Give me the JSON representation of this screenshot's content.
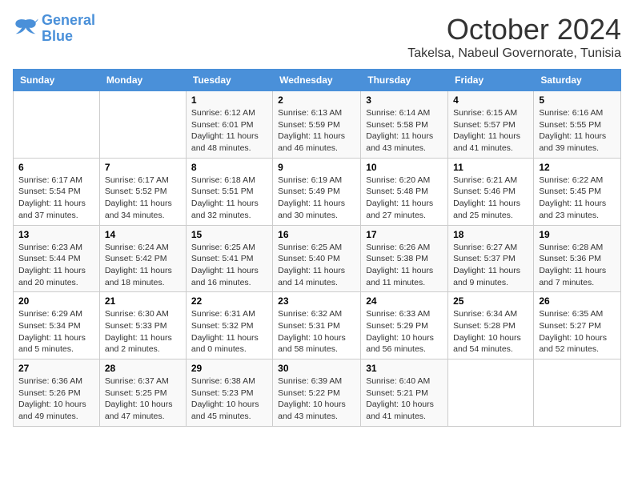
{
  "logo": {
    "line1": "General",
    "line2": "Blue"
  },
  "title": "October 2024",
  "subtitle": "Takelsa, Nabeul Governorate, Tunisia",
  "days_of_week": [
    "Sunday",
    "Monday",
    "Tuesday",
    "Wednesday",
    "Thursday",
    "Friday",
    "Saturday"
  ],
  "weeks": [
    [
      {
        "day": "",
        "info": ""
      },
      {
        "day": "",
        "info": ""
      },
      {
        "day": "1",
        "info": "Sunrise: 6:12 AM\nSunset: 6:01 PM\nDaylight: 11 hours and 48 minutes."
      },
      {
        "day": "2",
        "info": "Sunrise: 6:13 AM\nSunset: 5:59 PM\nDaylight: 11 hours and 46 minutes."
      },
      {
        "day": "3",
        "info": "Sunrise: 6:14 AM\nSunset: 5:58 PM\nDaylight: 11 hours and 43 minutes."
      },
      {
        "day": "4",
        "info": "Sunrise: 6:15 AM\nSunset: 5:57 PM\nDaylight: 11 hours and 41 minutes."
      },
      {
        "day": "5",
        "info": "Sunrise: 6:16 AM\nSunset: 5:55 PM\nDaylight: 11 hours and 39 minutes."
      }
    ],
    [
      {
        "day": "6",
        "info": "Sunrise: 6:17 AM\nSunset: 5:54 PM\nDaylight: 11 hours and 37 minutes."
      },
      {
        "day": "7",
        "info": "Sunrise: 6:17 AM\nSunset: 5:52 PM\nDaylight: 11 hours and 34 minutes."
      },
      {
        "day": "8",
        "info": "Sunrise: 6:18 AM\nSunset: 5:51 PM\nDaylight: 11 hours and 32 minutes."
      },
      {
        "day": "9",
        "info": "Sunrise: 6:19 AM\nSunset: 5:49 PM\nDaylight: 11 hours and 30 minutes."
      },
      {
        "day": "10",
        "info": "Sunrise: 6:20 AM\nSunset: 5:48 PM\nDaylight: 11 hours and 27 minutes."
      },
      {
        "day": "11",
        "info": "Sunrise: 6:21 AM\nSunset: 5:46 PM\nDaylight: 11 hours and 25 minutes."
      },
      {
        "day": "12",
        "info": "Sunrise: 6:22 AM\nSunset: 5:45 PM\nDaylight: 11 hours and 23 minutes."
      }
    ],
    [
      {
        "day": "13",
        "info": "Sunrise: 6:23 AM\nSunset: 5:44 PM\nDaylight: 11 hours and 20 minutes."
      },
      {
        "day": "14",
        "info": "Sunrise: 6:24 AM\nSunset: 5:42 PM\nDaylight: 11 hours and 18 minutes."
      },
      {
        "day": "15",
        "info": "Sunrise: 6:25 AM\nSunset: 5:41 PM\nDaylight: 11 hours and 16 minutes."
      },
      {
        "day": "16",
        "info": "Sunrise: 6:25 AM\nSunset: 5:40 PM\nDaylight: 11 hours and 14 minutes."
      },
      {
        "day": "17",
        "info": "Sunrise: 6:26 AM\nSunset: 5:38 PM\nDaylight: 11 hours and 11 minutes."
      },
      {
        "day": "18",
        "info": "Sunrise: 6:27 AM\nSunset: 5:37 PM\nDaylight: 11 hours and 9 minutes."
      },
      {
        "day": "19",
        "info": "Sunrise: 6:28 AM\nSunset: 5:36 PM\nDaylight: 11 hours and 7 minutes."
      }
    ],
    [
      {
        "day": "20",
        "info": "Sunrise: 6:29 AM\nSunset: 5:34 PM\nDaylight: 11 hours and 5 minutes."
      },
      {
        "day": "21",
        "info": "Sunrise: 6:30 AM\nSunset: 5:33 PM\nDaylight: 11 hours and 2 minutes."
      },
      {
        "day": "22",
        "info": "Sunrise: 6:31 AM\nSunset: 5:32 PM\nDaylight: 11 hours and 0 minutes."
      },
      {
        "day": "23",
        "info": "Sunrise: 6:32 AM\nSunset: 5:31 PM\nDaylight: 10 hours and 58 minutes."
      },
      {
        "day": "24",
        "info": "Sunrise: 6:33 AM\nSunset: 5:29 PM\nDaylight: 10 hours and 56 minutes."
      },
      {
        "day": "25",
        "info": "Sunrise: 6:34 AM\nSunset: 5:28 PM\nDaylight: 10 hours and 54 minutes."
      },
      {
        "day": "26",
        "info": "Sunrise: 6:35 AM\nSunset: 5:27 PM\nDaylight: 10 hours and 52 minutes."
      }
    ],
    [
      {
        "day": "27",
        "info": "Sunrise: 6:36 AM\nSunset: 5:26 PM\nDaylight: 10 hours and 49 minutes."
      },
      {
        "day": "28",
        "info": "Sunrise: 6:37 AM\nSunset: 5:25 PM\nDaylight: 10 hours and 47 minutes."
      },
      {
        "day": "29",
        "info": "Sunrise: 6:38 AM\nSunset: 5:23 PM\nDaylight: 10 hours and 45 minutes."
      },
      {
        "day": "30",
        "info": "Sunrise: 6:39 AM\nSunset: 5:22 PM\nDaylight: 10 hours and 43 minutes."
      },
      {
        "day": "31",
        "info": "Sunrise: 6:40 AM\nSunset: 5:21 PM\nDaylight: 10 hours and 41 minutes."
      },
      {
        "day": "",
        "info": ""
      },
      {
        "day": "",
        "info": ""
      }
    ]
  ]
}
